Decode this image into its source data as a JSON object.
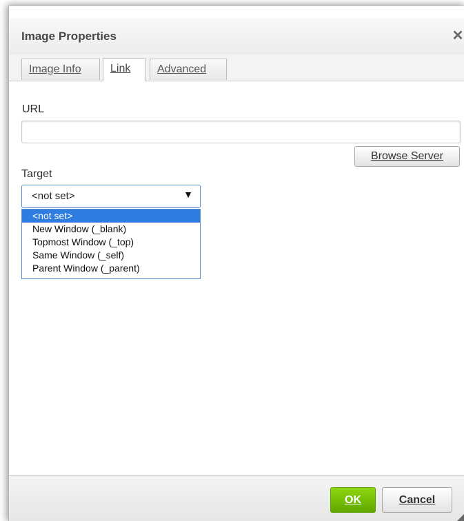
{
  "dialog": {
    "title": "Image Properties",
    "close_glyph": "✕",
    "close_icon": "close-icon"
  },
  "tabs": [
    {
      "label": "Image Info",
      "active": false
    },
    {
      "label": "Link",
      "active": true
    },
    {
      "label": "Advanced",
      "active": false
    }
  ],
  "link": {
    "url_label": "URL",
    "url_value": "",
    "browse_button": "Browse Server",
    "target_label": "Target",
    "target_selected": "<not set>",
    "dropdown_arrow": "▼",
    "dropdown_icon": "chevron-down-icon",
    "target_options": [
      "<not set>",
      "New Window (_blank)",
      "Topmost Window (_top)",
      "Same Window (_self)",
      "Parent Window (_parent)"
    ]
  },
  "footer": {
    "ok_label": "OK",
    "cancel_label": "Cancel",
    "resize_icon": "resize-grip-icon"
  },
  "colors": {
    "active_option": "#2f7de0",
    "ok_button": "#6cba00",
    "select_border": "#5a8ecb"
  }
}
